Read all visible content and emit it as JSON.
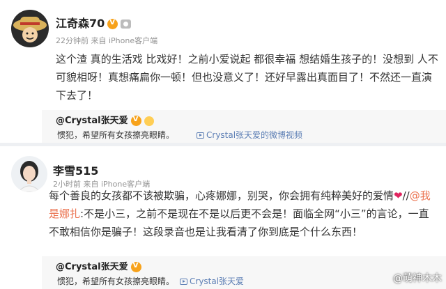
{
  "post1": {
    "author": "江奇森70",
    "meta": "22分钟前  来自 iPhone客户端",
    "text": "这个渣 真的生活戏 比戏好！之前小爱说起 都很幸福 想结婚生孩子的！没想到 人不可貌相呀！真想痛扁你一顿！但也没意义了！还好早露出真面目了！不然还一直演下去了！",
    "repost": {
      "name": "@Crystal张天爱",
      "text": "惯犯，希望所有女孩擦亮眼睛。",
      "video_link": "Crystal张天爱的微博视频"
    }
  },
  "post2": {
    "author": "李雪515",
    "meta": "2小时前  来自 iPhone客户端",
    "text_part1": "每个善良的女孩都不该被欺骗，心疼娜娜，别哭，你会拥有纯粹美好的爱情",
    "heart": "❤",
    "text_sep": "//",
    "mention": "@我是娜扎",
    "text_part2": ":不是小三，之前不是现在不是以后更不会是！面临全网“小三”的言论，一直不敢相信你是骗子！这段录音也是让我看清了你到底是个什么东西！",
    "repost": {
      "name": "@Crystal张天爱",
      "text": "惯犯，希望所有女孩擦亮眼睛。",
      "video_link": "Crystal张天爱"
    }
  },
  "watermark": "@萌神木木",
  "colors": {
    "mention": "#eb7350",
    "link": "#5d7fb5",
    "verified": "#f7a21b",
    "repost_bg": "#f7f7f7"
  }
}
